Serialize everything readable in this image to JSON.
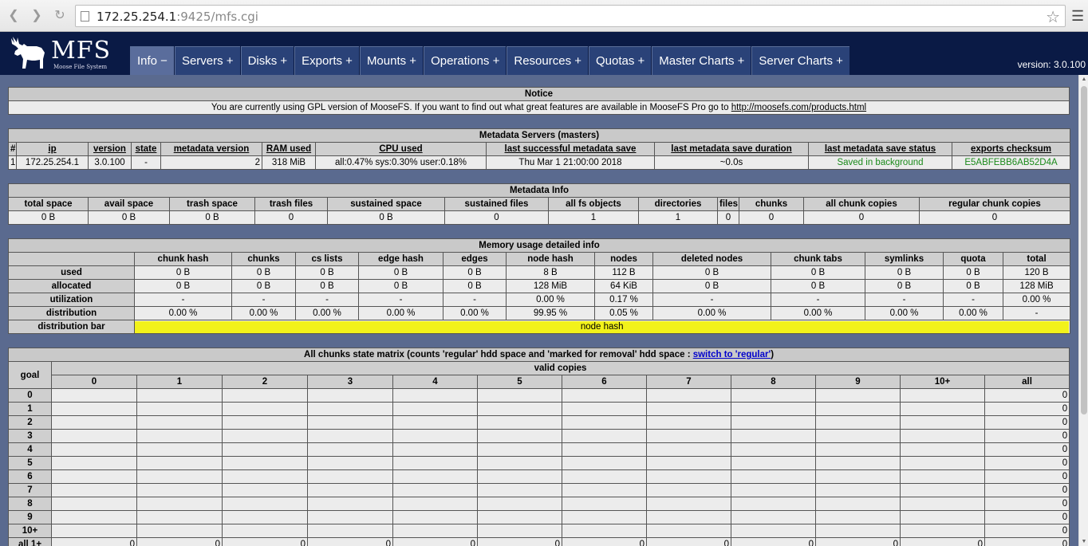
{
  "browser": {
    "url_host": "172.25.254.1",
    "url_rest": ":9425/mfs.cgi"
  },
  "header": {
    "logo_text": "MFS",
    "logo_subtext": "Moose File System",
    "version": "version: 3.0.100",
    "tabs": [
      "Info −",
      "Servers +",
      "Disks +",
      "Exports +",
      "Mounts +",
      "Operations +",
      "Resources +",
      "Quotas +",
      "Master Charts +",
      "Server Charts +"
    ]
  },
  "notice": {
    "title": "Notice",
    "text": "You are currently using GPL version of MooseFS. If you want to find out what great features are available in MooseFS Pro go to ",
    "link": "http://moosefs.com/products.html"
  },
  "masters": {
    "title": "Metadata Servers (masters)",
    "headers": [
      "#",
      "ip",
      "version",
      "state",
      "metadata version",
      "RAM used",
      "CPU used",
      "last successful metadata save",
      "last metadata save duration",
      "last metadata save status",
      "exports checksum"
    ],
    "row": [
      "1",
      "172.25.254.1",
      "3.0.100",
      "-",
      "2",
      "318 MiB",
      "all:0.47% sys:0.30% user:0.18%",
      "Thu Mar 1 21:00:00 2018",
      "~0.0s",
      "Saved in background",
      "E5ABFEBB6AB52D4A"
    ]
  },
  "metadata_info": {
    "title": "Metadata Info",
    "headers": [
      "total space",
      "avail space",
      "trash space",
      "trash files",
      "sustained space",
      "sustained files",
      "all fs objects",
      "directories",
      "files",
      "chunks",
      "all chunk copies",
      "regular chunk copies"
    ],
    "row": [
      "0 B",
      "0 B",
      "0 B",
      "0",
      "0 B",
      "0",
      "1",
      "1",
      "0",
      "0",
      "0",
      "0"
    ]
  },
  "memory": {
    "title": "Memory usage detailed info",
    "headers": [
      "",
      "chunk hash",
      "chunks",
      "cs lists",
      "edge hash",
      "edges",
      "node hash",
      "nodes",
      "deleted nodes",
      "chunk tabs",
      "symlinks",
      "quota",
      "total"
    ],
    "rows": [
      [
        "used",
        "0 B",
        "0 B",
        "0 B",
        "0 B",
        "0 B",
        "8 B",
        "112 B",
        "0 B",
        "0 B",
        "0 B",
        "0 B",
        "120 B"
      ],
      [
        "allocated",
        "0 B",
        "0 B",
        "0 B",
        "0 B",
        "0 B",
        "128 MiB",
        "64 KiB",
        "0 B",
        "0 B",
        "0 B",
        "0 B",
        "128 MiB"
      ],
      [
        "utilization",
        "-",
        "-",
        "-",
        "-",
        "-",
        "0.00 %",
        "0.17 %",
        "-",
        "-",
        "-",
        "-",
        "0.00 %"
      ],
      [
        "distribution",
        "0.00 %",
        "0.00 %",
        "0.00 %",
        "0.00 %",
        "0.00 %",
        "99.95 %",
        "0.05 %",
        "0.00 %",
        "0.00 %",
        "0.00 %",
        "0.00 %",
        "-"
      ]
    ],
    "bar_label": "distribution bar",
    "bar_text": "node hash",
    "bar_fraction": 0.9995
  },
  "matrix": {
    "title_pre": "All chunks state matrix (counts 'regular' hdd space and 'marked for removal' hdd space : ",
    "title_link": "switch to 'regular'",
    "title_post": ")",
    "goal_label": "goal",
    "valid_label": "valid copies",
    "columns": [
      "0",
      "1",
      "2",
      "3",
      "4",
      "5",
      "6",
      "7",
      "8",
      "9",
      "10+",
      "all"
    ],
    "rows": [
      "0",
      "1",
      "2",
      "3",
      "4",
      "5",
      "6",
      "7",
      "8",
      "9",
      "10+"
    ],
    "all_value": "0",
    "last_row_label": "all 1+",
    "last_row_value": "0"
  }
}
